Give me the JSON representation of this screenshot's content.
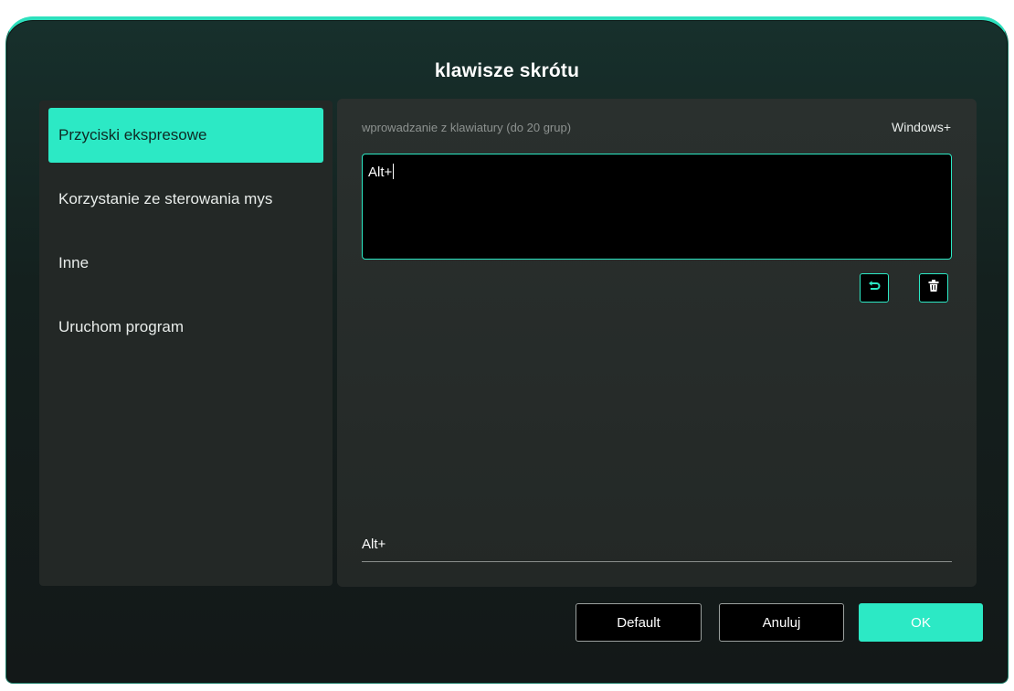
{
  "dialog": {
    "title": "klawisze skrótu"
  },
  "sidebar": {
    "items": [
      {
        "label": "Przyciski ekspresowe",
        "active": true
      },
      {
        "label": "Korzystanie ze sterowania mys",
        "active": false
      },
      {
        "label": "Inne",
        "active": false
      },
      {
        "label": "Uruchom program",
        "active": false
      }
    ]
  },
  "content": {
    "input_caption": "wprowadzanie z klawiatury (do 20 grup)",
    "windows_label": "Windows+",
    "key_input_value": "Alt+",
    "result_value": "Alt+",
    "undo_icon": "undo-icon",
    "trash_icon": "trash-icon"
  },
  "footer": {
    "default_label": "Default",
    "cancel_label": "Anuluj",
    "ok_label": "OK"
  },
  "colors": {
    "accent": "#2ce9c5",
    "dialog_bg": "#14201e",
    "panel_bg": "#232826"
  }
}
